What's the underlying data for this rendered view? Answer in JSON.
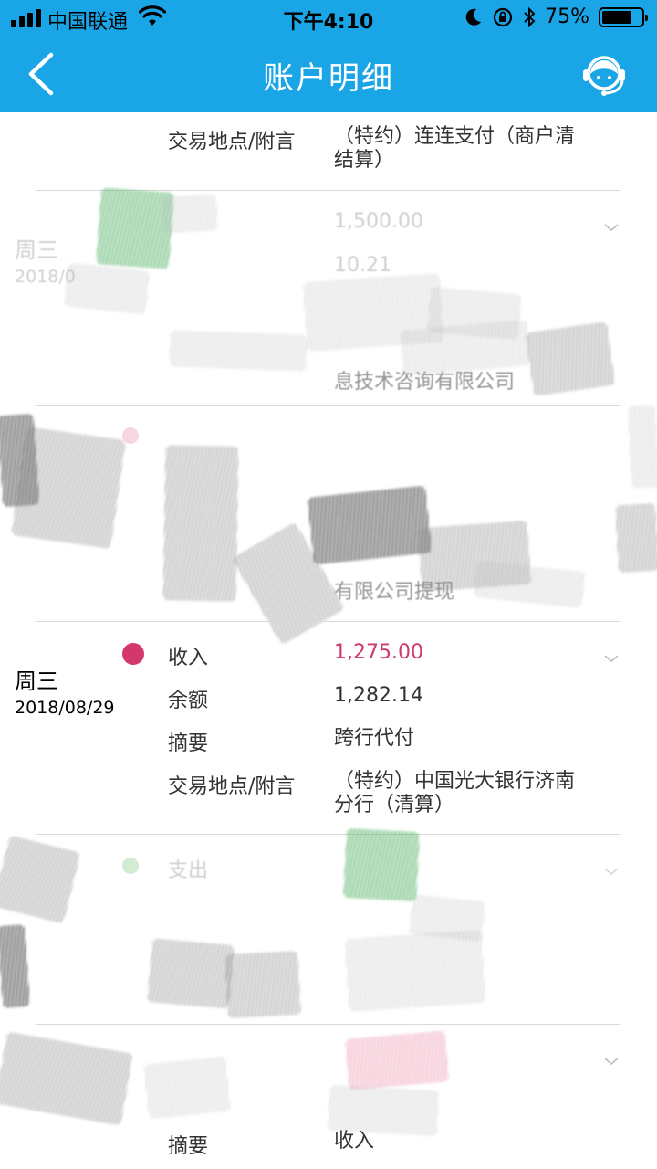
{
  "status_bar": {
    "carrier": "中国联通",
    "time": "下午4:10",
    "battery_percent": "75%",
    "battery_level": 0.75
  },
  "nav": {
    "title": "账户明细",
    "back_icon": "chevron-left-icon",
    "service_icon": "customer-service-icon"
  },
  "labels": {
    "income": "收入",
    "balance": "余额",
    "summary": "摘要",
    "location_note": "交易地点/附言",
    "expense": "支出"
  },
  "top_partial": {
    "location_note_value": "（特约）连连支付（商户清结算）"
  },
  "redacted_1": {
    "day": "周三",
    "date": "2018/0",
    "amount": "1,500.00",
    "balance": "10.21",
    "note": "息技术咨询有限公司"
  },
  "redacted_2": {
    "note": "有限公司提现"
  },
  "transaction": {
    "day": "周三",
    "date": "2018/08/29",
    "type": "收入",
    "amount": "1,275.00",
    "balance": "1,282.14",
    "summary": "跨行代付",
    "location_note": "（特约）中国光大银行济南分行（清算）"
  },
  "bottom_partial": {
    "summary_label": "摘要",
    "summary_value": "收入"
  },
  "colors": {
    "nav_bg": "#1aa5e6",
    "income_dot": "#d2386b",
    "expense_dot": "#4caf50",
    "divider": "#d9d9d9"
  }
}
